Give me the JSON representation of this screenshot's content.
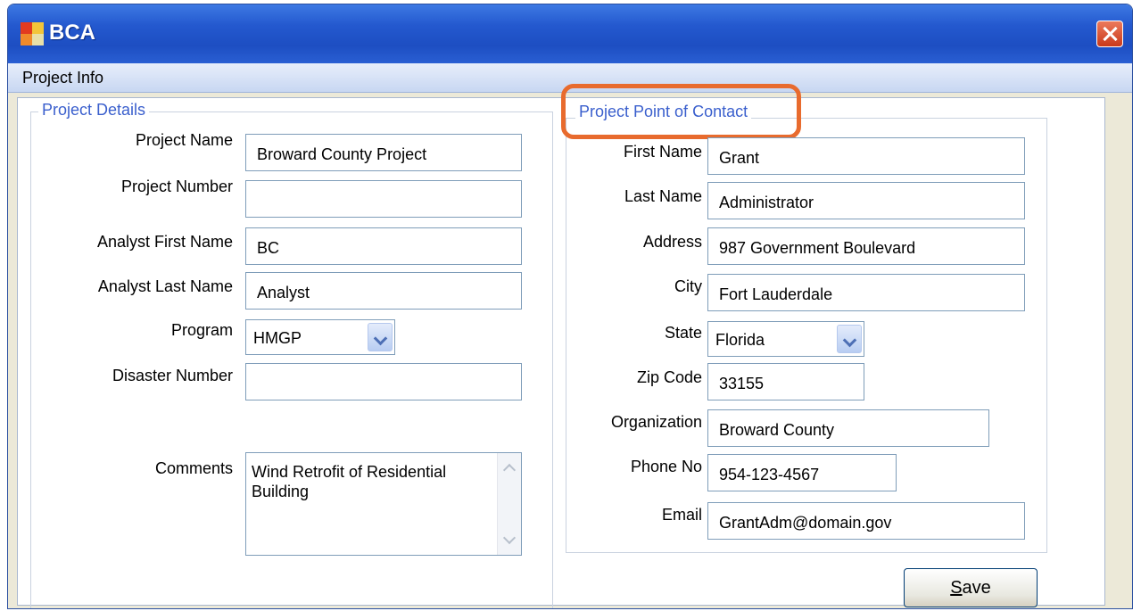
{
  "window": {
    "title": "BCA"
  },
  "tabs": [
    {
      "label": "Project Info"
    }
  ],
  "project_details": {
    "legend": "Project Details",
    "fields": {
      "project_name": {
        "label": "Project Name",
        "value": "Broward County Project"
      },
      "project_number": {
        "label": "Project Number",
        "value": ""
      },
      "analyst_first_name": {
        "label": "Analyst First Name",
        "value": "BC"
      },
      "analyst_last_name": {
        "label": "Analyst Last Name",
        "value": "Analyst"
      },
      "program": {
        "label": "Program",
        "value": "HMGP"
      },
      "disaster_number": {
        "label": "Disaster Number",
        "value": ""
      },
      "comments": {
        "label": "Comments",
        "value": "Wind Retrofit of Residential Building"
      }
    }
  },
  "point_of_contact": {
    "legend": "Project Point of Contact",
    "fields": {
      "first_name": {
        "label": "First Name",
        "value": "Grant"
      },
      "last_name": {
        "label": "Last Name",
        "value": "Administrator"
      },
      "address": {
        "label": "Address",
        "value": "987 Government Boulevard"
      },
      "city": {
        "label": "City",
        "value": "Fort Lauderdale"
      },
      "state": {
        "label": "State",
        "value": "Florida"
      },
      "zip": {
        "label": "Zip Code",
        "value": "33155"
      },
      "organization": {
        "label": "Organization",
        "value": "Broward County"
      },
      "phone": {
        "label": "Phone No",
        "value": "954-123-4567"
      },
      "email": {
        "label": "Email",
        "value": "GrantAdm@domain.gov"
      }
    }
  },
  "save_button": {
    "label_underlined": "S",
    "label_rest": "ave"
  },
  "colors": {
    "title_bar": "#2459cf",
    "legend_text": "#3a5fcd",
    "highlight": "#e86b2e",
    "close_button": "#c9391a"
  }
}
